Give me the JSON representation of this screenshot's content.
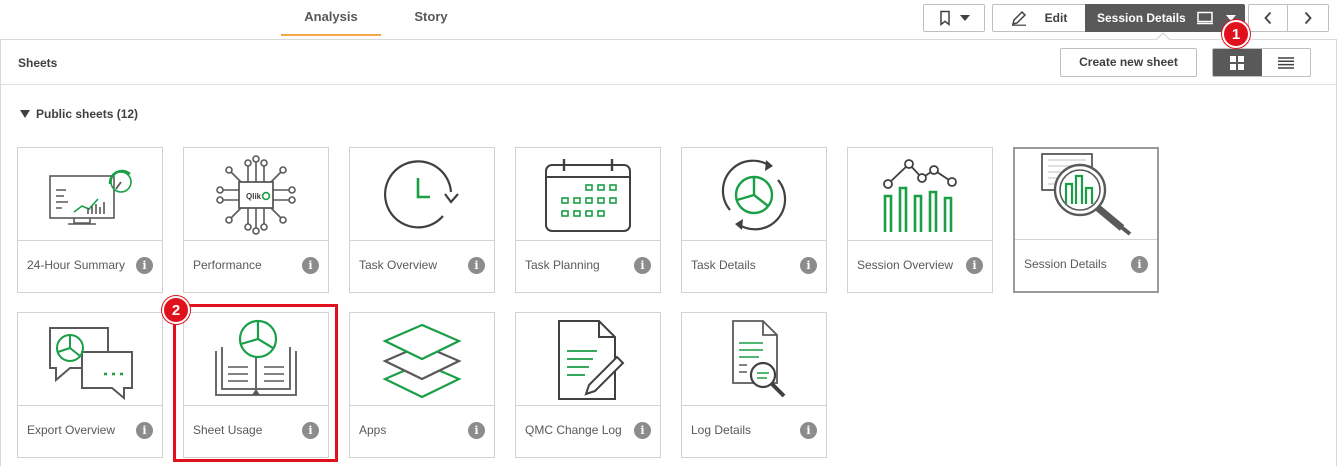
{
  "tabs": [
    {
      "label": "Analysis",
      "active": true
    },
    {
      "label": "Story",
      "active": false
    }
  ],
  "toolbar": {
    "bookmark_icon": "bookmark-icon",
    "edit_label": "Edit",
    "session_label": "Session Details",
    "session_icon": "presentation-icon",
    "prev_icon": "chevron-left-icon",
    "next_icon": "chevron-right-icon"
  },
  "badges": {
    "one": "1",
    "two": "2"
  },
  "panel": {
    "title": "Sheets",
    "create_label": "Create new sheet",
    "view_grid_icon": "grid-view-icon",
    "view_list_icon": "list-view-icon",
    "section_label": "Public sheets (12)"
  },
  "sheets": [
    {
      "label": "24-Hour Summary",
      "icon": "dashboard-monitor-icon"
    },
    {
      "label": "Performance",
      "icon": "qlik-chip-icon"
    },
    {
      "label": "Task Overview",
      "icon": "clock-icon"
    },
    {
      "label": "Task Planning",
      "icon": "calendar-icon"
    },
    {
      "label": "Task Details",
      "icon": "refresh-pie-icon"
    },
    {
      "label": "Session Overview",
      "icon": "bar-line-chart-icon"
    },
    {
      "label": "Session Details",
      "icon": "magnifier-chart-icon",
      "selected": true
    },
    {
      "label": "Export Overview",
      "icon": "chat-bubbles-icon"
    },
    {
      "label": "Sheet Usage",
      "icon": "book-pie-icon"
    },
    {
      "label": "Apps",
      "icon": "layers-icon"
    },
    {
      "label": "QMC Change Log",
      "icon": "document-pencil-icon"
    },
    {
      "label": "Log Details",
      "icon": "document-search-icon"
    }
  ],
  "colors": {
    "accent_green": "#1a9e46",
    "icon_gray": "#595959",
    "highlight_red": "#e0101c",
    "tab_underline": "#f0a84a"
  }
}
